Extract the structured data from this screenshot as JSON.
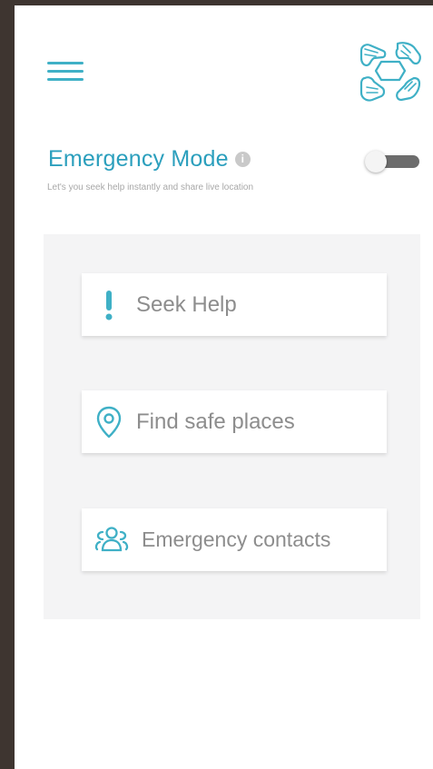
{
  "header": {
    "menu_icon": "hamburger-menu-icon",
    "logo_icon": "hands-circle-logo"
  },
  "emergency": {
    "title": "Emergency Mode",
    "info_icon": "info-icon",
    "subtitle": "Let's you seek help instantly and share live location",
    "toggle_on": false
  },
  "actions": [
    {
      "label": "Seek Help",
      "icon": "exclamation-icon"
    },
    {
      "label": "Find safe places",
      "icon": "location-pin-icon"
    },
    {
      "label": "Emergency contacts",
      "icon": "group-contacts-icon"
    }
  ],
  "colors": {
    "accent": "#3fb0c6",
    "title": "#2b9fbd",
    "panel": "#f4f4f5",
    "text_muted": "#8d8d8d",
    "toggle_track": "#6d6d6d"
  }
}
